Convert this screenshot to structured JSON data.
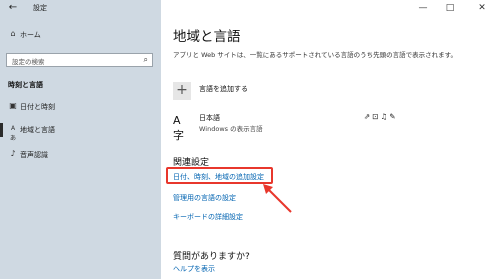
{
  "window": {
    "app_title": "設定",
    "back_glyph": "←",
    "minimize_glyph": "—",
    "maximize_glyph": "□",
    "close_glyph": "✕"
  },
  "sidebar": {
    "home": {
      "label": "ホーム",
      "icon": "home-icon",
      "glyph": "⌂"
    },
    "search": {
      "placeholder": "設定の検索",
      "icon": "search-icon",
      "glyph": "⌕"
    },
    "section": "時刻と言語",
    "items": [
      {
        "label": "日付と時刻",
        "icon": "calendar-clock-icon",
        "glyph": "▣"
      },
      {
        "label": "地域と言語",
        "icon": "globe-language-icon",
        "glyph": "Aあ",
        "active": true
      },
      {
        "label": "音声認識",
        "icon": "microphone-icon",
        "glyph": "♪"
      }
    ]
  },
  "main": {
    "title": "地域と言語",
    "description": "アプリと Web サイトは、一覧にあるサポートされている言語のうち先頭の言語で表示されます。",
    "add_language": {
      "label": "言語を追加する",
      "glyph": "+"
    },
    "language": {
      "name": "日本語",
      "subtitle": "Windows の表示言語",
      "icon_glyph": "A字",
      "feature_icons": "⇗⊡♫✎"
    },
    "related": {
      "title": "関連設定",
      "links": [
        "日付、時刻、地域の追加設定",
        "管理用の言語の設定",
        "キーボードの詳細設定"
      ]
    },
    "faq": {
      "title": "質問がありますか?",
      "help_link": "ヘルプを表示"
    }
  },
  "annotation": {
    "color": "#e8372c"
  }
}
